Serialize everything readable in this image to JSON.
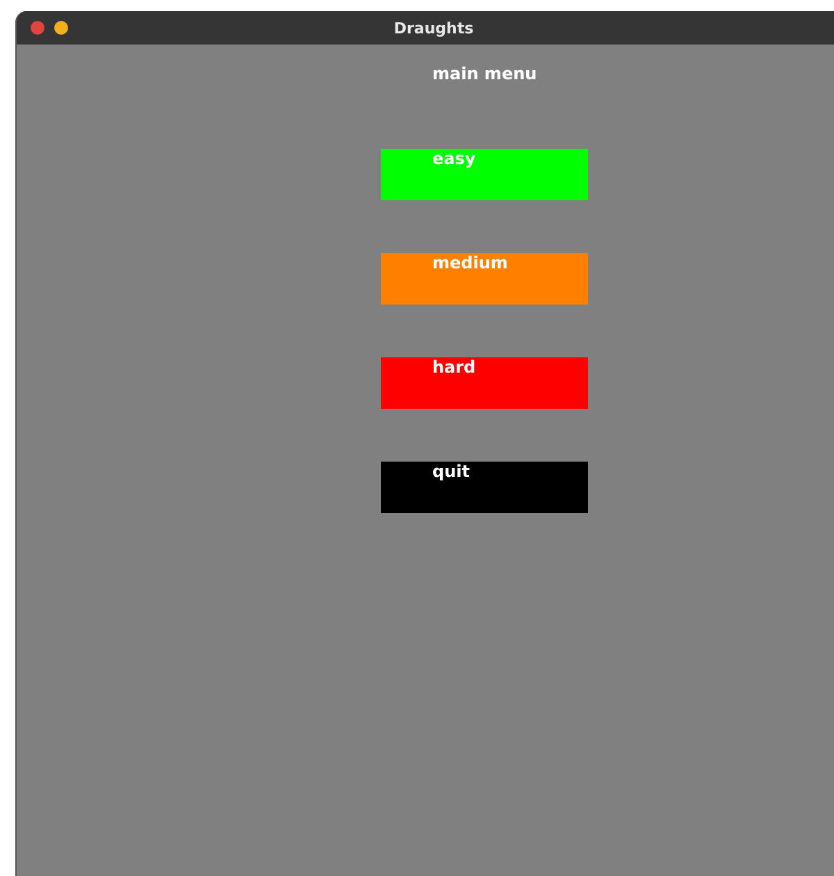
{
  "window": {
    "title": "Draughts"
  },
  "heading": "main menu",
  "buttons": [
    {
      "label": "easy",
      "color": "#00ff00"
    },
    {
      "label": "medium",
      "color": "#ff8000"
    },
    {
      "label": "hard",
      "color": "#ff0000"
    },
    {
      "label": "quit",
      "color": "#000000"
    }
  ]
}
